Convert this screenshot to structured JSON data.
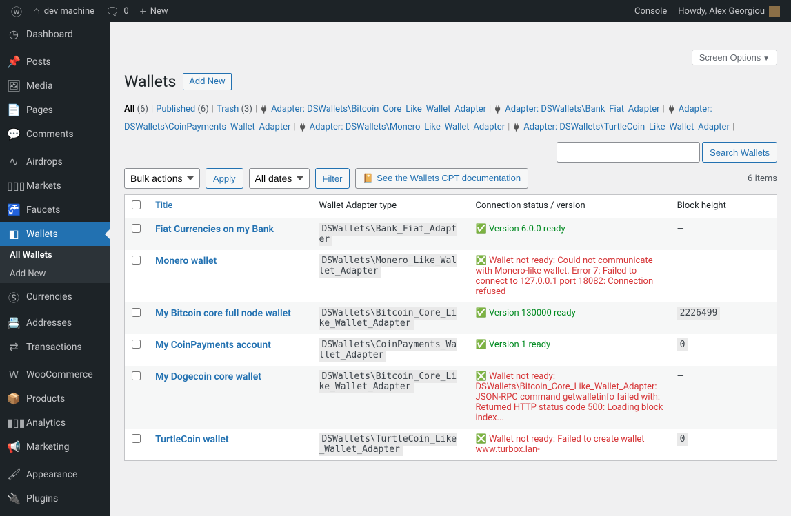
{
  "adminbar": {
    "site_name": "dev machine",
    "comments": "0",
    "new": "New",
    "console": "Console",
    "howdy": "Howdy, Alex Georgiou"
  },
  "sidebar": {
    "items": [
      {
        "icon": "◷",
        "label": "Dashboard",
        "name": "dashboard"
      },
      {
        "sep": true
      },
      {
        "icon": "📌",
        "label": "Posts",
        "name": "posts"
      },
      {
        "icon": "🖼",
        "label": "Media",
        "name": "media"
      },
      {
        "icon": "📄",
        "label": "Pages",
        "name": "pages"
      },
      {
        "icon": "💬",
        "label": "Comments",
        "name": "comments"
      },
      {
        "sep": true
      },
      {
        "icon": "∿",
        "label": "Airdrops",
        "name": "airdrops"
      },
      {
        "icon": "▯▯▯",
        "label": "Markets",
        "name": "markets"
      },
      {
        "icon": "🚰",
        "label": "Faucets",
        "name": "faucets"
      },
      {
        "icon": "◧",
        "label": "Wallets",
        "name": "wallets",
        "active": true,
        "submenu": [
          {
            "label": "All Wallets",
            "current": true
          },
          {
            "label": "Add New"
          }
        ]
      },
      {
        "icon": "Ⓢ",
        "label": "Currencies",
        "name": "currencies"
      },
      {
        "icon": "📇",
        "label": "Addresses",
        "name": "addresses"
      },
      {
        "icon": "⇄",
        "label": "Transactions",
        "name": "transactions"
      },
      {
        "sep": true
      },
      {
        "icon": "W",
        "label": "WooCommerce",
        "name": "woocommerce"
      },
      {
        "icon": "📦",
        "label": "Products",
        "name": "products"
      },
      {
        "icon": "▮▯▮",
        "label": "Analytics",
        "name": "analytics"
      },
      {
        "icon": "📢",
        "label": "Marketing",
        "name": "marketing"
      },
      {
        "sep": true
      },
      {
        "icon": "🖌",
        "label": "Appearance",
        "name": "appearance"
      },
      {
        "icon": "🔌",
        "label": "Plugins",
        "name": "plugins"
      }
    ]
  },
  "screen_options": "Screen Options",
  "page_title": "Wallets",
  "add_new": "Add New",
  "filters": {
    "all": {
      "label": "All",
      "count": "(6)"
    },
    "published": {
      "label": "Published",
      "count": "(6)"
    },
    "trash": {
      "label": "Trash",
      "count": "(3)"
    },
    "adapters": [
      "Adapter: DSWallets\\Bitcoin_Core_Like_Wallet_Adapter",
      "Adapter: DSWallets\\Bank_Fiat_Adapter",
      "Adapter: DSWallets\\CoinPayments_Wallet_Adapter",
      "Adapter: DSWallets\\Monero_Like_Wallet_Adapter",
      "Adapter: DSWallets\\TurtleCoin_Like_Wallet_Adapter"
    ]
  },
  "search": {
    "button": "Search Wallets"
  },
  "bulk_actions": "Bulk actions",
  "apply": "Apply",
  "all_dates": "All dates",
  "filter": "Filter",
  "doc_link": "📔 See the Wallets CPT documentation",
  "items_count": "6 items",
  "columns": {
    "title": "Title",
    "adapter": "Wallet Adapter type",
    "status": "Connection status / version",
    "block": "Block height"
  },
  "rows": [
    {
      "title": "Fiat Currencies on my Bank",
      "adapter": " DSWallets\\Bank_Fiat_Adapter ",
      "status_icon": "✅",
      "status_text": "Version 6.0.0 ready",
      "status_ok": true,
      "block": "—"
    },
    {
      "title": "Monero wallet",
      "adapter": " DSWallets\\Monero_Like_Wallet_Adapter ",
      "status_icon": "❎",
      "status_text": "Wallet not ready: Could not communicate with Monero-like wallet. Error 7: Failed to connect to 127.0.0.1 port 18082: Connection refused",
      "status_ok": false,
      "block": "—"
    },
    {
      "title": "My Bitcoin core full node wallet",
      "adapter": " DSWallets\\Bitcoin_Core_Like_Wallet_Adapter ",
      "status_icon": "✅",
      "status_text": "Version 130000 ready",
      "status_ok": true,
      "block": "2226499",
      "block_code": true
    },
    {
      "title": "My CoinPayments account",
      "adapter": " DSWallets\\CoinPayments_Wallet_Adapter ",
      "status_icon": "✅",
      "status_text": "Version 1 ready",
      "status_ok": true,
      "block": "0",
      "block_code": true
    },
    {
      "title": "My Dogecoin core wallet",
      "adapter": " DSWallets\\Bitcoin_Core_Like_Wallet_Adapter ",
      "status_icon": "❎",
      "status_text": "Wallet not ready: DSWallets\\Bitcoin_Core_Like_Wallet_Adapter: JSON-RPC command getwalletinfo failed with: Returned HTTP status code 500: Loading block index...",
      "status_ok": false,
      "block": "—"
    },
    {
      "title": "TurtleCoin wallet",
      "adapter": " DSWallets\\TurtleCoin_Like_Wallet_Adapter ",
      "status_icon": "❎",
      "status_text": "Wallet not ready: Failed to create wallet www.turbox.lan-",
      "status_ok": false,
      "block": "0",
      "block_code": true
    }
  ]
}
